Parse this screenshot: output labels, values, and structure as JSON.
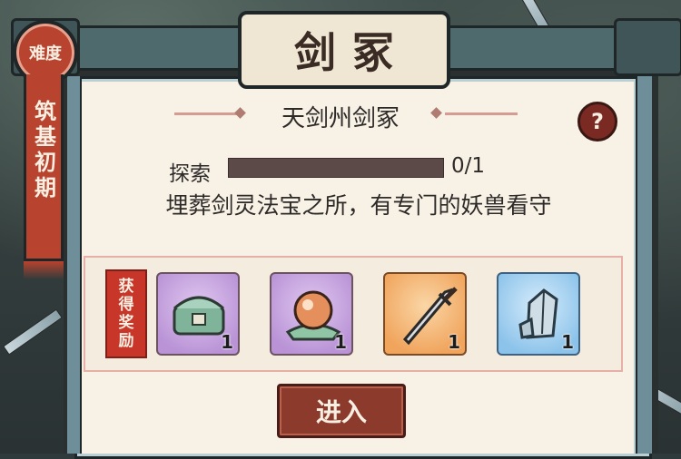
{
  "title": "剑冢",
  "difficulty": {
    "label": "难度",
    "level": "筑基初期"
  },
  "level_name": "天剑州剑冢",
  "help_icon_text": "?",
  "explore": {
    "label": "探索",
    "current": 0,
    "total": 1,
    "value_text": "0/1"
  },
  "description": "埋葬剑灵法宝之所，有专门的妖兽看守",
  "rewards": {
    "stamp_chars": [
      "获",
      "得",
      "奖",
      "励"
    ],
    "items": [
      {
        "icon": "jade-chest-icon",
        "rarity": "purple",
        "qty": "1"
      },
      {
        "icon": "spirit-orb-icon",
        "rarity": "purple",
        "qty": "1"
      },
      {
        "icon": "sword-icon",
        "rarity": "orange",
        "qty": "1"
      },
      {
        "icon": "ore-crystal-icon",
        "rarity": "blue",
        "qty": "1"
      }
    ]
  },
  "enter_button": "进入",
  "colors": {
    "accent_red": "#b8432e",
    "paper": "#f7f1e6",
    "button": "#8b3a2c"
  }
}
